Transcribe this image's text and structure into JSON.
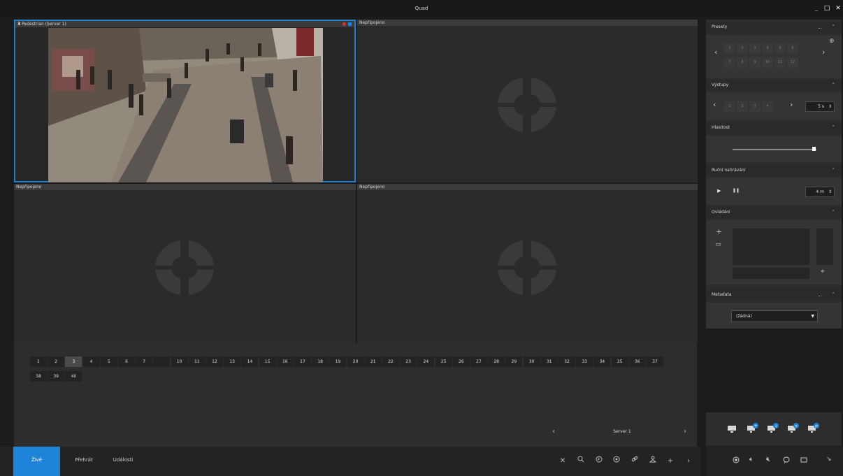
{
  "window": {
    "title": "Quad",
    "minimize": "_",
    "maximize": "□",
    "close": "✕"
  },
  "tiles": [
    {
      "title_num": "3",
      "title": "Pedestrian (Server 1)",
      "status": "live"
    },
    {
      "title": "Nepřipojeno"
    },
    {
      "title": "Nepřipojeno"
    },
    {
      "title": "Nepřipojeno"
    }
  ],
  "camera_numbers_row1": [
    "1",
    "2",
    "3",
    "4",
    "5",
    "6",
    "7",
    "",
    "10",
    "11",
    "12",
    "13",
    "14",
    "15",
    "16",
    "17",
    "18",
    "19",
    "20",
    "21",
    "22",
    "23",
    "24",
    "25",
    "26",
    "27",
    "28",
    "29",
    "30",
    "31",
    "32",
    "33",
    "34",
    "35",
    "36",
    "37"
  ],
  "camera_numbers_row2": [
    "38",
    "39",
    "40"
  ],
  "selected_camera": "3",
  "server_nav": {
    "prev": "‹",
    "label": "Server 1",
    "next": "›"
  },
  "tabs": {
    "live": "Živě",
    "playback": "Přehrát",
    "events": "Události"
  },
  "bottom_icons": [
    "close-icon",
    "search-icon",
    "clock-icon",
    "target-icon",
    "link-icon",
    "user-icon",
    "plus-icon",
    "chevron-right-icon"
  ],
  "sections": {
    "presets": {
      "title": "Presety",
      "dots": "...",
      "chev": "^",
      "row1": [
        "1",
        "2",
        "3",
        "4",
        "5",
        "6"
      ],
      "row2": [
        "7",
        "8",
        "9",
        "10",
        "11",
        "12"
      ],
      "prev": "‹",
      "next": "›",
      "add": "⊕"
    },
    "outputs": {
      "title": "Výstupy",
      "chev": "^",
      "items": [
        "1",
        "2",
        "3",
        "4"
      ],
      "prev": "‹",
      "next": "›",
      "duration": "5 s"
    },
    "volume": {
      "title": "Hlasitost",
      "chev": "^",
      "level": 0.95
    },
    "manual_rec": {
      "title": "Ruční nahrávání",
      "chev": "^",
      "play": "▶",
      "pause": "❚❚",
      "duration": "4 m"
    },
    "controls": {
      "title": "Ovládání",
      "chev": "^",
      "plus": "+",
      "rect": "▭",
      "crosshair": "⌖"
    },
    "metadata": {
      "title": "Metadata",
      "dots": "...",
      "chev": "^",
      "select_value": "(žádná)"
    }
  },
  "colors": {
    "accent": "#1d84d7",
    "selection_border": "#1f7fd0",
    "rec_dot": "#e0322a"
  }
}
